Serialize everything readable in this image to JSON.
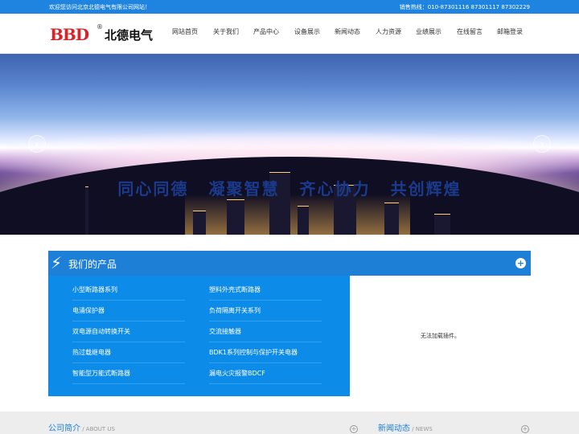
{
  "topbar": {
    "welcome": "欢迎您访问北京北德电气有限公司网站！",
    "hotline_label": "销售热线：",
    "hotline_numbers": "010-87301116   87301117   87302229"
  },
  "logo": {
    "mark": "BBD",
    "reg": "®",
    "name": "北德电气"
  },
  "nav": [
    {
      "label": "网站首页"
    },
    {
      "label": "关于我们"
    },
    {
      "label": "产品中心"
    },
    {
      "label": "设备展示"
    },
    {
      "label": "新闻动态"
    },
    {
      "label": "人力资源"
    },
    {
      "label": "业绩展示"
    },
    {
      "label": "在线留言"
    },
    {
      "label": "邮箱登录"
    }
  ],
  "banner": {
    "slogan": [
      "同心同德",
      "凝聚智慧",
      "齐心协力",
      "共创辉煌"
    ],
    "prev_icon": "‹",
    "next_icon": "›"
  },
  "products": {
    "title": "我们的产品",
    "expand_icon": "+",
    "bolt_icon": "⚡",
    "left": [
      "小型断路器系列",
      "电涌保护器",
      "双电源自动转换开关",
      "热过载继电器",
      "智能型万能式断路器"
    ],
    "right": [
      "塑料外壳式断路器",
      "负荷隔离开关系列",
      "交流接触器",
      "BDK1系列控制与保护开关电器",
      "漏电火灾报警BDCF"
    ],
    "plugin_message": "无法加载插件。"
  },
  "bottom": {
    "about_cn": "公司简介",
    "about_en": " / ABOUT US",
    "news_cn": "新闻动态",
    "news_en": " / NEWS",
    "more_icon": "+"
  },
  "colors": {
    "brand_blue": "#1e84e0",
    "logo_red": "#d8232a",
    "list_blue": "#0c8be8"
  }
}
